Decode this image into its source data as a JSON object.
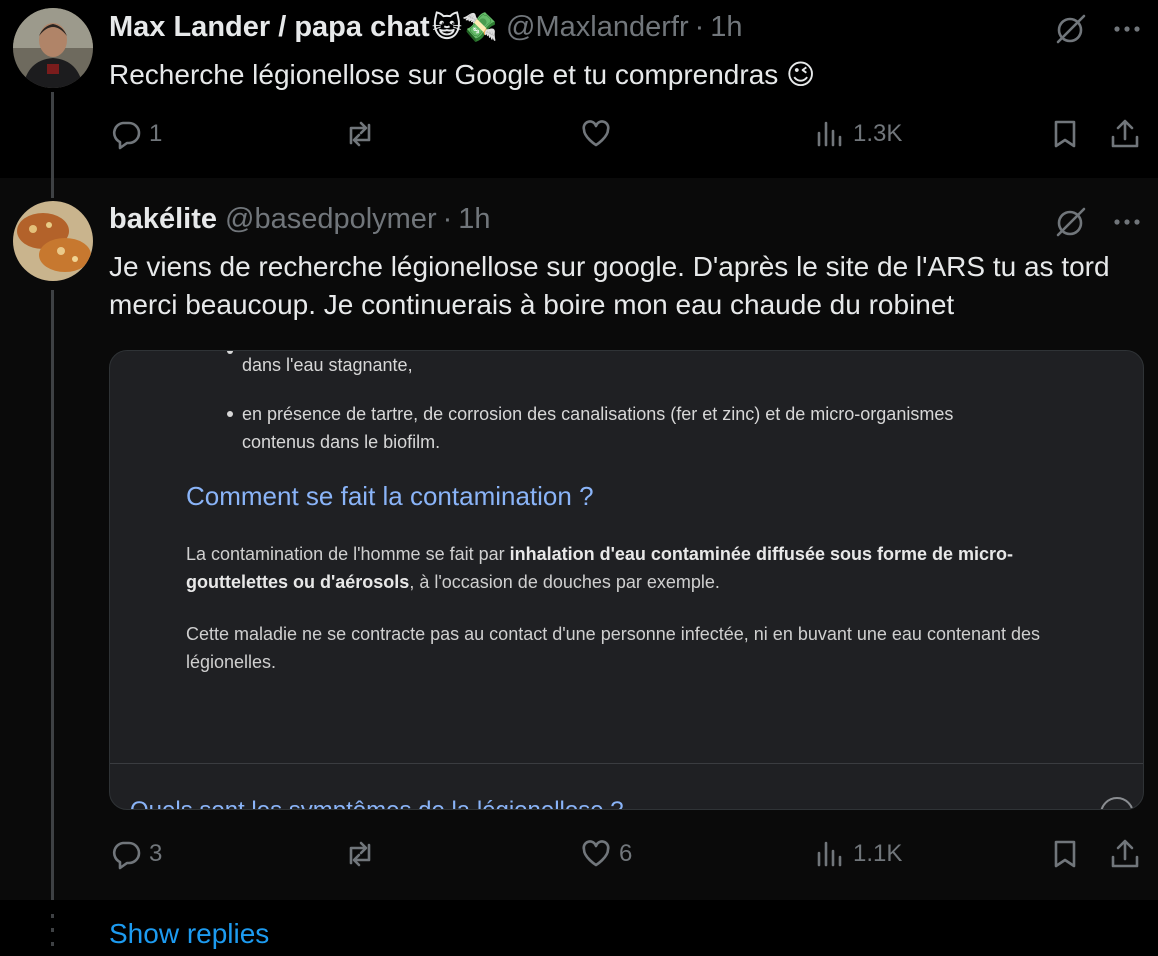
{
  "tweet1": {
    "name": "Max Lander / papa chat",
    "emoji": "😺💸",
    "handle": "@Maxlanderfr",
    "dot": "·",
    "time": "1h",
    "text": "Recherche légionellose sur Google et tu comprendras 😉",
    "stats": {
      "replies": "1",
      "retweets": "",
      "likes": "",
      "views": "1.3K"
    }
  },
  "tweet2": {
    "name": "bakélite",
    "handle": "@basedpolymer",
    "dot": "·",
    "time": "1h",
    "text": "Je viens de recherche légionellose sur google. D'après le site de l'ARS tu as tord merci beaucoup. Je continuerais à boire mon eau chaude du robinet",
    "stats": {
      "replies": "3",
      "retweets": "",
      "likes": "6",
      "views": "1.1K"
    },
    "card": {
      "bullet1": "dans l'eau stagnante,",
      "bullet2_line1": "en présence de tartre, de corrosion des canalisations (fer et zinc) et de micro-organismes",
      "bullet2_line2": "contenus dans le biofilm.",
      "heading": "Comment se fait la contamination ?",
      "p1_pre": "La contamination de l'homme se fait par ",
      "p1_bold1": "inhalation d'eau contaminée diffusée sous forme de micro-",
      "p1_bold2": "gouttelettes ou d'aérosols",
      "p1_post": ", à l'occasion de douches par exemple.",
      "p2": "Cette maladie ne se contracte pas au contact d'une personne infectée, ni en buvant une eau contenant des légionelles.",
      "cut_heading": "Quels sont les symptômes de la légionellose ?"
    }
  },
  "show_replies": "Show replies",
  "icons": [
    "grok-icon",
    "more-icon",
    "reply-icon",
    "retweet-icon",
    "like-icon",
    "views-icon",
    "bookmark-icon",
    "share-icon"
  ],
  "colors": {
    "accent": "#1d9bf0",
    "muted": "#71767b",
    "link_heading": "#8ab4f8"
  }
}
